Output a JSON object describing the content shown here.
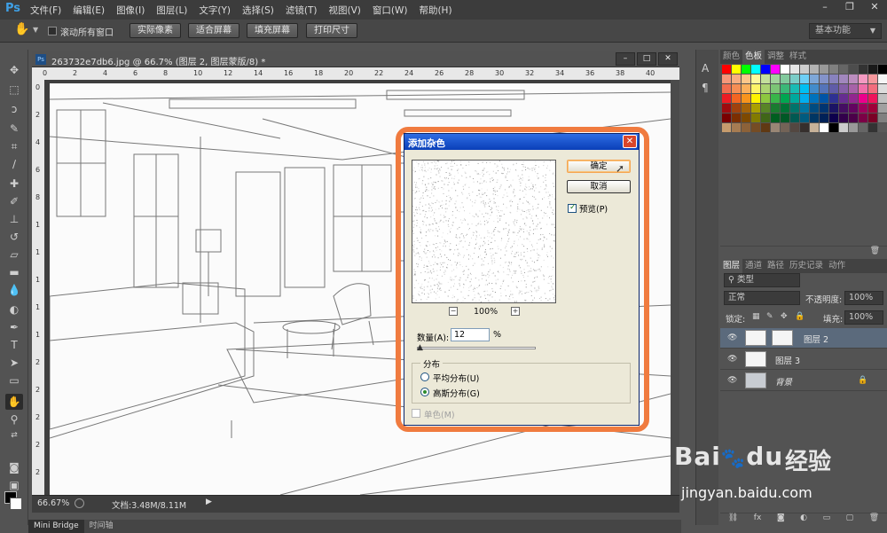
{
  "app": {
    "logo": "Ps"
  },
  "menu": [
    "文件(F)",
    "编辑(E)",
    "图像(I)",
    "图层(L)",
    "文字(Y)",
    "选择(S)",
    "滤镜(T)",
    "视图(V)",
    "窗口(W)",
    "帮助(H)"
  ],
  "options_bar": {
    "scroll_all_label": "滚动所有窗口",
    "buttons": [
      "实际像素",
      "适合屏幕",
      "填充屏幕",
      "打印尺寸"
    ],
    "workspace": "基本功能"
  },
  "document": {
    "title": "263732e7db6.jpg @ 66.7% (图层 2, 图层蒙版/8) *",
    "zoom": "66.67%",
    "info": "文档:3.48M/8.11M",
    "ruler_h": [
      "0",
      "2",
      "4",
      "6",
      "8",
      "10",
      "12",
      "14",
      "16",
      "18",
      "20",
      "22",
      "24",
      "26",
      "28",
      "30",
      "32",
      "34",
      "36",
      "38",
      "40"
    ],
    "ruler_v": [
      "0",
      "2",
      "4",
      "6",
      "8",
      "1",
      "1",
      "1",
      "1",
      "1",
      "2",
      "2",
      "2",
      "2",
      "2"
    ]
  },
  "bottom_tabs": [
    "Mini Bridge",
    "时间轴"
  ],
  "swatches_panel": {
    "tabs": [
      "颜色",
      "色板",
      "调整",
      "样式"
    ],
    "active": 1
  },
  "layers_panel": {
    "tabs": [
      "图层",
      "通道",
      "路径",
      "历史记录",
      "动作"
    ],
    "filter": "类型",
    "blend_mode": "正常",
    "opacity_label": "不透明度:",
    "opacity": "100%",
    "lock_label": "锁定:",
    "fill_label": "填充:",
    "fill": "100%",
    "layers": [
      {
        "name": "图层 2",
        "active": true
      },
      {
        "name": "图层 3",
        "active": false
      },
      {
        "name": "背景",
        "active": false
      }
    ]
  },
  "dialog": {
    "title": "添加杂色",
    "ok": "确定",
    "cancel": "取消",
    "preview_label": "预览(P)",
    "preview_checked": true,
    "zoom": "100%",
    "amount_label": "数量(A):",
    "amount": "12",
    "amount_unit": "%",
    "distribution_title": "分布",
    "uniform": "平均分布(U)",
    "gaussian": "高斯分布(G)",
    "selected": "gaussian",
    "monochrome": "单色(M)"
  },
  "watermark": {
    "brand": "Bai",
    "brand2": "du",
    "cn": "经验",
    "url": "jingyan.baidu.com"
  },
  "colors": {
    "accent": "#f07b3f",
    "titlebar": "#0a3fb8",
    "ui_bg": "#535353"
  }
}
